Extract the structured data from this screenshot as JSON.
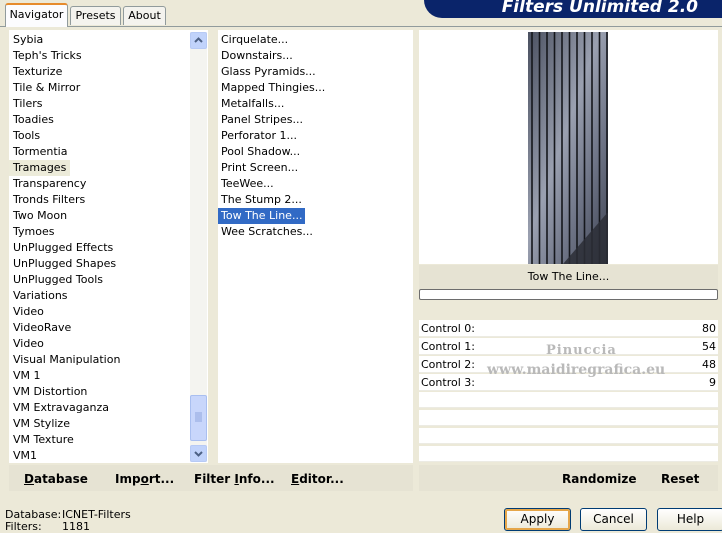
{
  "tabs": [
    {
      "label": "Navigator",
      "active": true
    },
    {
      "label": "Presets",
      "active": false
    },
    {
      "label": "About",
      "active": false
    }
  ],
  "banner_title": "Filters Unlimited 2.0",
  "categories": [
    "Sybia",
    "Teph's Tricks",
    "Texturize",
    "Tile & Mirror",
    "Tilers",
    "Toadies",
    "Tools",
    "Tormentia",
    "Tramages",
    "Transparency",
    "Tronds Filters",
    "Two Moon",
    "Tymoes",
    "UnPlugged Effects",
    "UnPlugged Shapes",
    "UnPlugged Tools",
    "Variations",
    "Video",
    "VideoRave",
    "Video",
    "Visual Manipulation",
    "VM 1",
    "VM Distortion",
    "VM Extravaganza",
    "VM Stylize",
    "VM Texture",
    "VM1"
  ],
  "selected_category": "Tramages",
  "filters": [
    "Cirquelate...",
    "Downstairs...",
    "Glass Pyramids...",
    "Mapped Thingies...",
    "Metalfalls...",
    "Panel Stripes...",
    "Perforator 1...",
    "Pool Shadow...",
    "Print Screen...",
    "TeeWee...",
    "The Stump 2...",
    "Tow The Line...",
    "Wee Scratches..."
  ],
  "selected_filter": "Tow The Line...",
  "preview_caption": "Tow The Line...",
  "controls": [
    {
      "label": "Control 0:",
      "value": "80"
    },
    {
      "label": "Control 1:",
      "value": "54"
    },
    {
      "label": "Control 2:",
      "value": "48"
    },
    {
      "label": "Control 3:",
      "value": "9"
    }
  ],
  "watermark": {
    "line1": "Pinuccia",
    "line2": "www.maidiregrafica.eu"
  },
  "left_buttons": {
    "database": {
      "u": "D",
      "rest": "atabase"
    },
    "import": {
      "pre": "Imp",
      "u": "o",
      "rest": "rt..."
    },
    "filter_info": {
      "pre": "Filter ",
      "u": "I",
      "rest": "nfo..."
    },
    "editor": {
      "u": "E",
      "rest": "ditor..."
    }
  },
  "right_buttons": {
    "randomize": "Randomize",
    "reset": "Reset"
  },
  "status": {
    "database_label": "Database:",
    "database_value": "ICNET-Filters",
    "filters_label": "Filters:",
    "filters_value": "1181"
  },
  "dialog_buttons": {
    "apply": "Apply",
    "cancel": "Cancel",
    "help": "Help"
  },
  "colors": {
    "selection_blue": "#316ac5",
    "banner_navy": "#0a246a",
    "focus_orange": "#e5a64a"
  }
}
